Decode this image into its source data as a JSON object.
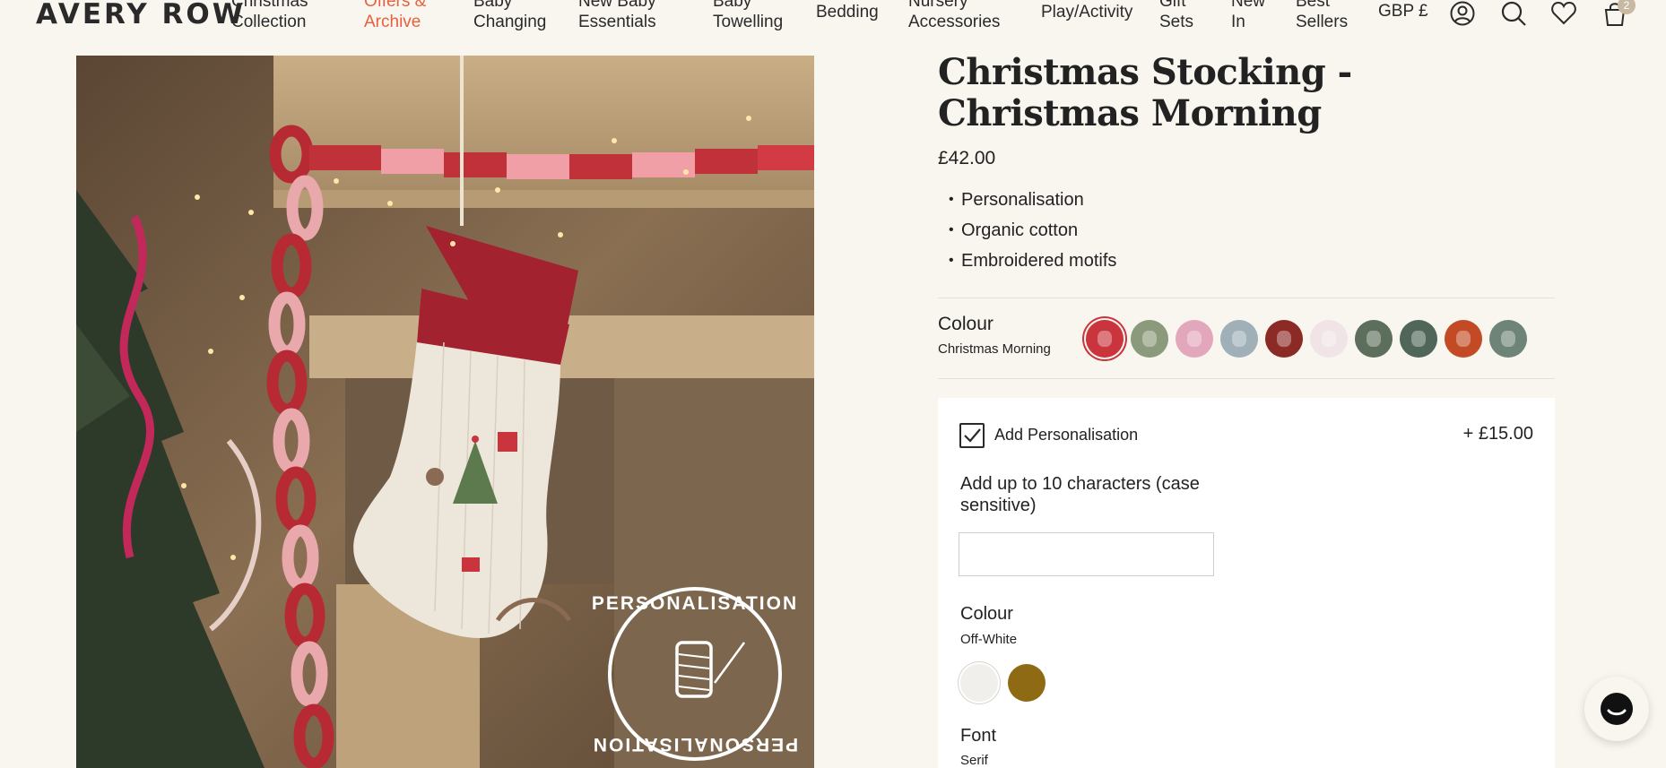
{
  "brand": {
    "name": "AVERY ROW"
  },
  "nav": {
    "items": [
      {
        "line1": "Christmas",
        "line2": "Collection"
      },
      {
        "line1": "Offers &",
        "line2": "Archive"
      },
      {
        "line1": "Baby",
        "line2": "Changing"
      },
      {
        "line1": "New Baby",
        "line2": "Essentials"
      },
      {
        "line1": "Baby",
        "line2": "Towelling"
      },
      {
        "line1": "Bedding",
        "line2": ""
      },
      {
        "line1": "Nursery",
        "line2": "Accessories"
      },
      {
        "line1": "Play/Activity",
        "line2": ""
      },
      {
        "line1": "Gift",
        "line2": "Sets"
      },
      {
        "line1": "New",
        "line2": "In"
      },
      {
        "line1": "Best",
        "line2": "Sellers"
      }
    ],
    "currency": "GBP £",
    "cart_count": "2",
    "icons": [
      "account-icon",
      "search-icon",
      "heart-icon",
      "bag-icon"
    ]
  },
  "product_image": {
    "badge_text_top": "PERSONALISATION",
    "badge_text_bottom": "PERSONALISATION"
  },
  "product": {
    "title": "Christmas Stocking - Christmas Morning",
    "price": "£42.00",
    "features": [
      "Personalisation",
      "Organic cotton",
      "Embroidered motifs"
    ],
    "colour_label": "Colour",
    "colour_value": "Christmas Morning",
    "swatches": [
      {
        "color": "#c9343d",
        "selected": true
      },
      {
        "color": "#8b9a7a",
        "selected": false
      },
      {
        "color": "#e3a7bb",
        "selected": false
      },
      {
        "color": "#9fb0b8",
        "selected": false
      },
      {
        "color": "#8c2a26",
        "selected": false
      },
      {
        "color": "#f1e4e6",
        "selected": false
      },
      {
        "color": "#5c6e5c",
        "selected": false
      },
      {
        "color": "#4f6658",
        "selected": false
      },
      {
        "color": "#c24a24",
        "selected": false
      },
      {
        "color": "#6f8478",
        "selected": false
      }
    ]
  },
  "personalisation": {
    "add_label": "Add Personalisation",
    "add_price": "+ £15.00",
    "checked": true,
    "instructions": "Add up to 10 characters (case sensitive)",
    "input_value": "",
    "colour_label": "Colour",
    "colour_value": "Off-White",
    "thread_swatches": [
      {
        "color": "#f1efec",
        "selected": true
      },
      {
        "color": "#8f6a14",
        "selected": false
      }
    ],
    "font_label": "Font",
    "font_value": "Serif"
  }
}
